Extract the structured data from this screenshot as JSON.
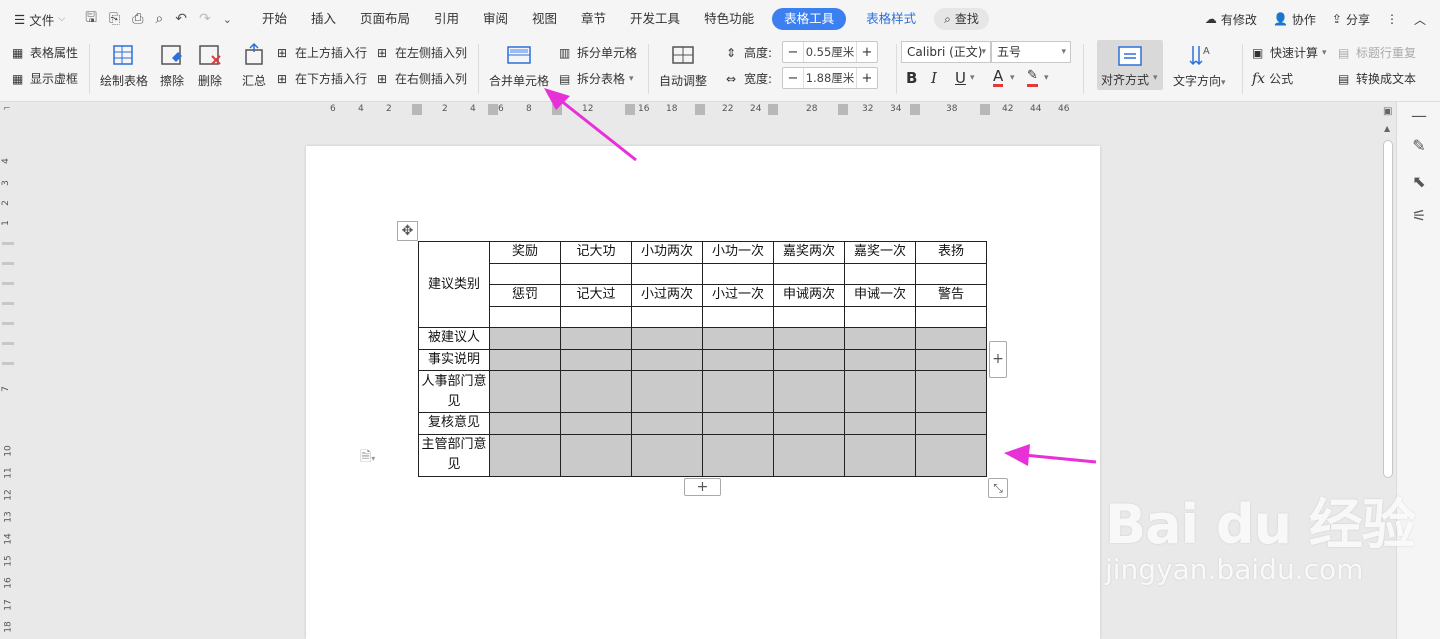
{
  "menubar": {
    "file_label": "文件",
    "tabs": [
      "开始",
      "插入",
      "页面布局",
      "引用",
      "审阅",
      "视图",
      "章节",
      "开发工具",
      "特色功能"
    ],
    "active_tab": "表格工具",
    "style_tab": "表格样式",
    "search_label": "查找",
    "right": {
      "modified": "有修改",
      "collab": "协作",
      "share": "分享"
    }
  },
  "ribbon": {
    "table_props": "表格属性",
    "show_grid": "显示虚框",
    "draw_table": "绘制表格",
    "erase": "擦除",
    "delete": "删除",
    "summary": "汇总",
    "insert_above": "在上方插入行",
    "insert_below": "在下方插入行",
    "insert_left": "在左侧插入列",
    "insert_right": "在右侧插入列",
    "merge_cells": "合并单元格",
    "split_cells": "拆分单元格",
    "split_table": "拆分表格",
    "auto_adjust": "自动调整",
    "height_label": "高度:",
    "height_value": "0.55厘米",
    "width_label": "宽度:",
    "width_value": "1.88厘米",
    "font_name": "Calibri (正文)",
    "font_size": "五号",
    "align": "对齐方式",
    "text_dir": "文字方向",
    "quick_calc": "快速计算",
    "header_repeat": "标题行重复",
    "formula": "公式",
    "to_text": "转换成文本",
    "minus": "−",
    "plus": "+"
  },
  "ruler": {
    "h_numbers": [
      "6",
      "4",
      "2",
      "2",
      "4",
      "6",
      "8",
      "12",
      "16",
      "18",
      "22",
      "24",
      "28",
      "32",
      "34",
      "38",
      "42",
      "44",
      "46"
    ],
    "v_numbers": [
      "4",
      "3",
      "2",
      "1",
      "7",
      "10",
      "11",
      "12",
      "13",
      "14",
      "15",
      "16",
      "17",
      "18"
    ]
  },
  "table": {
    "category_label": "建议类别",
    "reward_row": [
      "奖励",
      "记大功",
      "小功两次",
      "小功一次",
      "嘉奖两次",
      "嘉奖一次",
      "表扬"
    ],
    "punish_row": [
      "惩罚",
      "记大过",
      "小过两次",
      "小过一次",
      "申诫两次",
      "申诫一次",
      "警告"
    ],
    "rows": [
      {
        "label": "被建议人",
        "tall": false
      },
      {
        "label": "事实说明",
        "tall": false
      },
      {
        "label": "人事部门意见",
        "tall": true
      },
      {
        "label": "复核意见",
        "tall": false
      },
      {
        "label": "主管部门意见",
        "tall": true
      }
    ]
  },
  "watermark": {
    "brand": "Bai du 经验",
    "url": "jingyan.baidu.com"
  },
  "colors": {
    "accent": "#3b7ff0",
    "arrow": "#e830d8",
    "cell_gray": "#cacaca"
  }
}
